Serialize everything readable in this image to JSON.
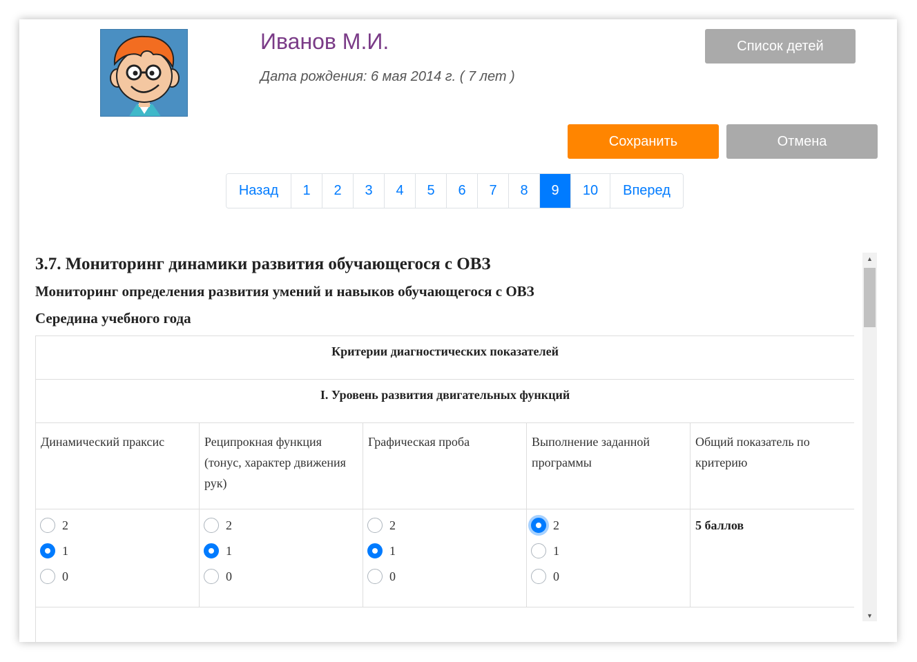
{
  "child": {
    "name": "Иванов М.И.",
    "dob": "Дата рождения: 6 мая 2014 г. ( 7 лет )"
  },
  "buttons": {
    "children_list": "Список детей",
    "save": "Сохранить",
    "cancel": "Отмена"
  },
  "pagination": {
    "back": "Назад",
    "pages": [
      "1",
      "2",
      "3",
      "4",
      "5",
      "6",
      "7",
      "8",
      "9",
      "10"
    ],
    "active_page": "9",
    "next": "Вперед"
  },
  "section": {
    "title": "3.7. Мониторинг динамики развития обучающегося с ОВЗ",
    "subtitle": "Мониторинг определения развития умений и навыков обучающегося с ОВЗ",
    "period": "Середина учебного года"
  },
  "table": {
    "criteria_header": "Критерии диагностических показателей",
    "group_header": "I. Уровень развития двигательных функций",
    "columns": [
      "Динамический праксис",
      "Реципрокная функция (тонус, характер движения рук)",
      "Графическая проба",
      "Выполнение заданной программы",
      "Общий показатель по критерию"
    ],
    "options": [
      "2",
      "1",
      "0"
    ],
    "selected": [
      "1",
      "1",
      "1",
      "2"
    ],
    "total": "5 баллов"
  },
  "colors": {
    "accent": "#007bff",
    "save": "#ff8500",
    "neutral_button": "#aaaaaa",
    "name": "#7a3b87"
  }
}
